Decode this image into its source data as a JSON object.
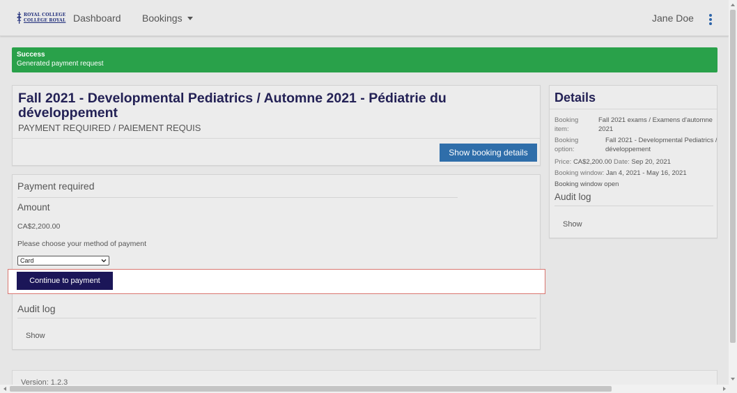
{
  "brand": {
    "line1": "ROYAL COLLEGE",
    "line2": "COLLÈGE ROYAL"
  },
  "nav": {
    "dashboard": "Dashboard",
    "bookings": "Bookings",
    "user": "Jane Doe"
  },
  "alert": {
    "title": "Success",
    "message": "Generated payment request"
  },
  "booking": {
    "title": "Fall 2021 - Developmental Pediatrics / Automne 2021 - Pédiatrie du développement",
    "status": "PAYMENT REQUIRED / PAIEMENT REQUIS",
    "details_button": "Show booking details"
  },
  "payment": {
    "heading": "Payment required",
    "amount_label": "Amount",
    "amount": "CA$2,200.00",
    "choose_label": "Please choose your method of payment",
    "method": "Card",
    "continue_button": "Continue to payment",
    "audit_heading": "Audit log",
    "audit_show": "Show"
  },
  "details": {
    "heading": "Details",
    "booking_item_label": "Booking item:",
    "booking_item_value_1": "Fall 2021 exams / Examens d'automne",
    "booking_item_value_2": "2021",
    "booking_option_label": "Booking option:",
    "booking_option_value_1": "Fall 2021 - Developmental Pediatrics /",
    "booking_option_value_2": "développement",
    "price_label": "Price:",
    "price_value": "CA$2,200.00",
    "date_label": "Date:",
    "date_value": "Sep 20, 2021",
    "window_label": "Booking window:",
    "window_value": "Jan 4, 2021 - May 16, 2021",
    "window_status": "Booking window open",
    "audit_heading": "Audit log",
    "audit_show": "Show"
  },
  "footer": {
    "version": "Version: 1.2.3"
  },
  "colors": {
    "success": "#29a14a",
    "primary": "#2f6eaa",
    "navy": "#1b1658",
    "heading": "#232155"
  }
}
